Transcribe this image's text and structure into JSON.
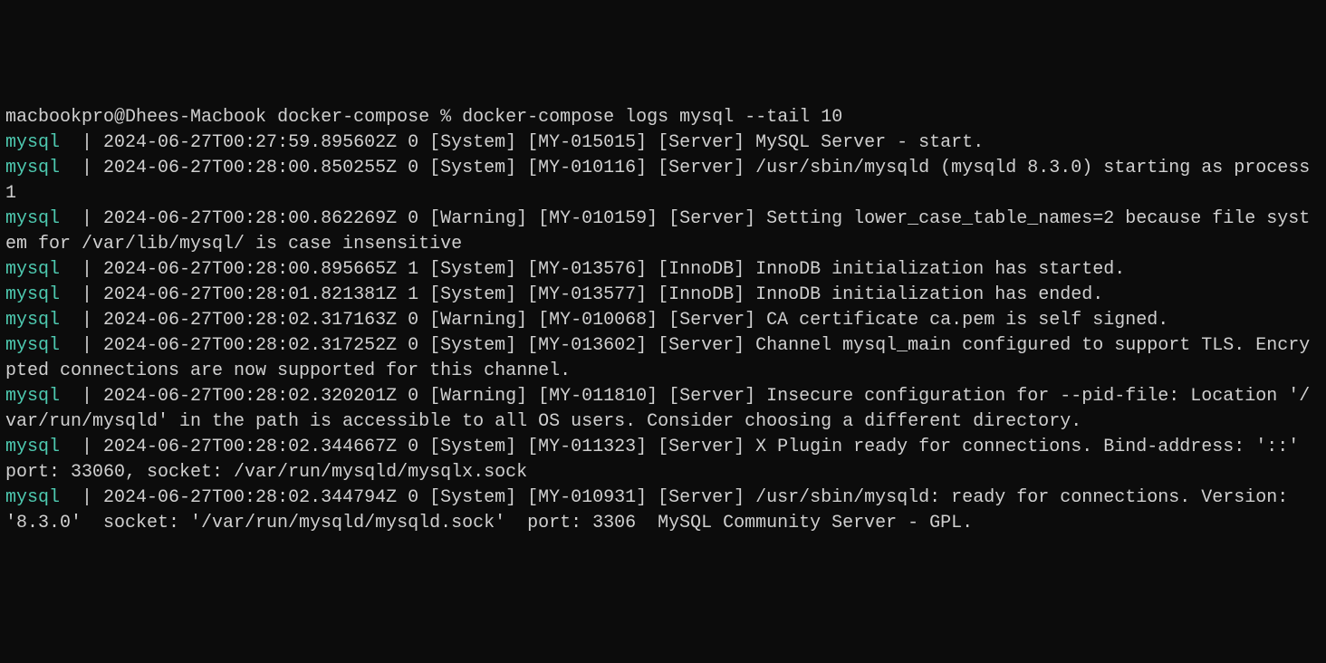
{
  "prompt": {
    "user_host": "macbookpro@Dhees-Macbook",
    "cwd": "docker-compose",
    "sep": "%",
    "command": "docker-compose logs mysql --tail 10"
  },
  "service_name": "mysql",
  "pipe": "  | ",
  "service_field_pad": "mysql  ",
  "logs": [
    {
      "prefix_only": false,
      "text": "2024-06-27T00:27:59.895602Z 0 [System] [MY-015015] [Server] MySQL Server - start."
    },
    {
      "text": "2024-06-27T00:28:00.850255Z 0 [System] [MY-010116] [Server] /usr/sbin/mysqld (mysqld 8.3.0) starting as process 1"
    },
    {
      "text": "2024-06-27T00:28:00.862269Z 0 [Warning] [MY-010159] [Server] Setting lower_case_table_names=2 because file system for /var/lib/mysql/ is case insensitive"
    },
    {
      "text": "2024-06-27T00:28:00.895665Z 1 [System] [MY-013576] [InnoDB] InnoDB initialization has started."
    },
    {
      "text": "2024-06-27T00:28:01.821381Z 1 [System] [MY-013577] [InnoDB] InnoDB initialization has ended."
    },
    {
      "text": "2024-06-27T00:28:02.317163Z 0 [Warning] [MY-010068] [Server] CA certificate ca.pem is self signed."
    },
    {
      "text": "2024-06-27T00:28:02.317252Z 0 [System] [MY-013602] [Server] Channel mysql_main configured to support TLS. Encrypted connections are now supported for this channel."
    },
    {
      "text": "2024-06-27T00:28:02.320201Z 0 [Warning] [MY-011810] [Server] Insecure configuration for --pid-file: Location '/var/run/mysqld' in the path is accessible to all OS users. Consider choosing a different directory."
    },
    {
      "text": "2024-06-27T00:28:02.344667Z 0 [System] [MY-011323] [Server] X Plugin ready for connections. Bind-address: '::' port: 33060, socket: /var/run/mysqld/mysqlx.sock"
    },
    {
      "text": "2024-06-27T00:28:02.344794Z 0 [System] [MY-010931] [Server] /usr/sbin/mysqld: ready for connections. Version: '8.3.0'  socket: '/var/run/mysqld/mysqld.sock'  port: 3306  MySQL Community Server - GPL."
    }
  ]
}
